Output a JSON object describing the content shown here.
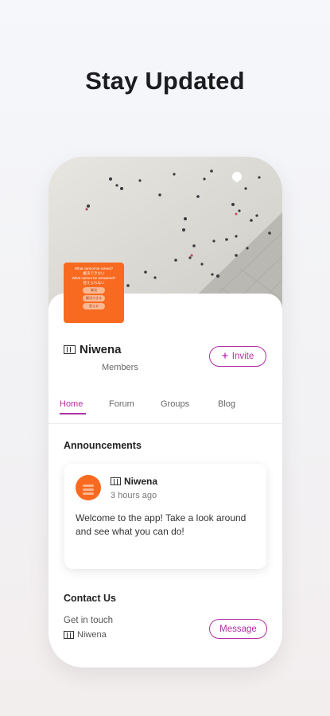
{
  "headline": "Stay Updated",
  "brand": {
    "name": "Niwena",
    "members_label": "Members",
    "invite_label": "Invite"
  },
  "avatar_tile": {
    "line1": "What cannot be solved?",
    "line2": "解決できない",
    "line3": "What cannot be answered?",
    "line4": "答えられない",
    "pills": [
      "解決",
      "解決できる",
      "答える"
    ]
  },
  "tabs": [
    "Home",
    "Forum",
    "Groups",
    "Blog"
  ],
  "announcements": {
    "title": "Announcements",
    "post": {
      "author": "Niwena",
      "time": "3 hours ago",
      "body": "Welcome to the app! Take a look around and see what you can do!"
    }
  },
  "contact": {
    "title": "Contact Us",
    "subtitle": "Get in touch",
    "name": "Niwena",
    "message_label": "Message"
  },
  "colors": {
    "accent": "#b12fa4",
    "brand_orange": "#f86a20"
  },
  "icons": [
    "chat-icon",
    "bell-icon",
    "plus-icon"
  ]
}
